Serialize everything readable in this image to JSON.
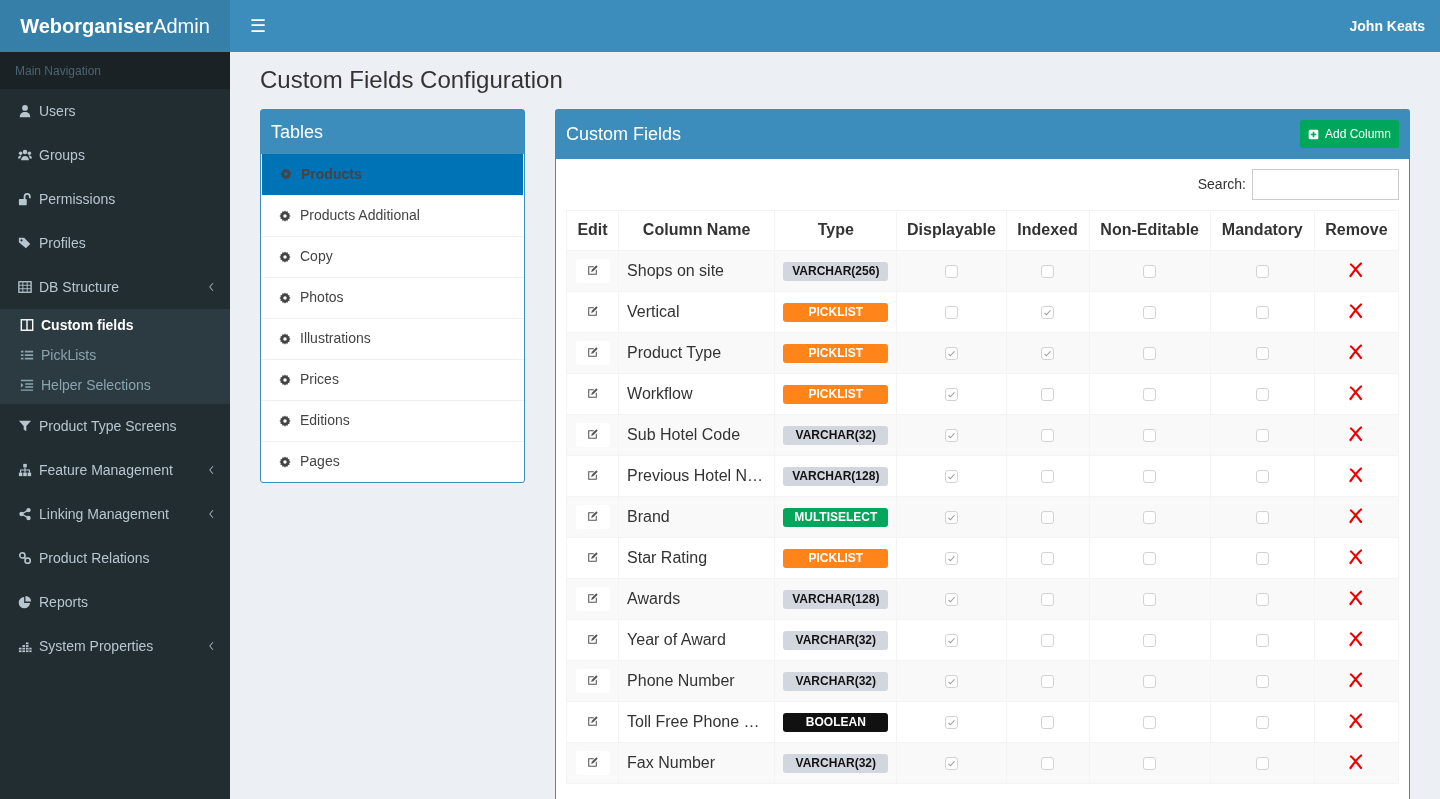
{
  "brand": {
    "bold": "Weborganiser",
    "light": "Admin"
  },
  "menu_toggle": "☰",
  "user": "John Keats",
  "sidebar": {
    "header": "Main Navigation",
    "items": [
      {
        "label": "Users",
        "submenu": false
      },
      {
        "label": "Groups",
        "submenu": false
      },
      {
        "label": "Permissions",
        "submenu": false
      },
      {
        "label": "Profiles",
        "submenu": false
      },
      {
        "label": "DB Structure",
        "submenu": true,
        "children": [
          {
            "label": "Custom fields",
            "selected": true
          },
          {
            "label": "PickLists",
            "selected": false
          },
          {
            "label": "Helper Selections",
            "selected": false
          }
        ]
      },
      {
        "label": "Product Type Screens",
        "submenu": false
      },
      {
        "label": "Feature Management",
        "submenu": true
      },
      {
        "label": "Linking Management",
        "submenu": true
      },
      {
        "label": "Product Relations",
        "submenu": false
      },
      {
        "label": "Reports",
        "submenu": false
      },
      {
        "label": "System Properties",
        "submenu": true
      }
    ]
  },
  "page_title": "Custom Fields Configuration",
  "tables_panel": {
    "title": "Tables",
    "items": [
      {
        "label": "Products",
        "selected": true
      },
      {
        "label": "Products Additional",
        "selected": false
      },
      {
        "label": "Copy",
        "selected": false
      },
      {
        "label": "Photos",
        "selected": false
      },
      {
        "label": "Illustrations",
        "selected": false
      },
      {
        "label": "Prices",
        "selected": false
      },
      {
        "label": "Editions",
        "selected": false
      },
      {
        "label": "Pages",
        "selected": false
      }
    ]
  },
  "fields_panel": {
    "title": "Custom Fields",
    "add_button": "Add Column",
    "search_label": "Search:",
    "columns": [
      "Edit",
      "Column Name",
      "Type",
      "Displayable",
      "Indexed",
      "Non-Editable",
      "Mandatory",
      "Remove"
    ],
    "rows": [
      {
        "name": "Shops on site",
        "type": "VARCHAR(256)",
        "kind": "varchar",
        "displayable": false,
        "indexed": false,
        "non_editable": false,
        "mandatory": false
      },
      {
        "name": "Vertical",
        "type": "PICKLIST",
        "kind": "picklist",
        "displayable": false,
        "indexed": true,
        "non_editable": false,
        "mandatory": false
      },
      {
        "name": "Product Type",
        "type": "PICKLIST",
        "kind": "picklist",
        "displayable": true,
        "indexed": true,
        "non_editable": false,
        "mandatory": false
      },
      {
        "name": "Workflow",
        "type": "PICKLIST",
        "kind": "picklist",
        "displayable": true,
        "indexed": false,
        "non_editable": false,
        "mandatory": false
      },
      {
        "name": "Sub Hotel Code",
        "type": "VARCHAR(32)",
        "kind": "varchar",
        "displayable": true,
        "indexed": false,
        "non_editable": false,
        "mandatory": false
      },
      {
        "name": "Previous Hotel N…",
        "type": "VARCHAR(128)",
        "kind": "varchar",
        "displayable": true,
        "indexed": false,
        "non_editable": false,
        "mandatory": false
      },
      {
        "name": "Brand",
        "type": "MULTISELECT",
        "kind": "multiselect",
        "displayable": true,
        "indexed": false,
        "non_editable": false,
        "mandatory": false
      },
      {
        "name": "Star Rating",
        "type": "PICKLIST",
        "kind": "picklist",
        "displayable": true,
        "indexed": false,
        "non_editable": false,
        "mandatory": false
      },
      {
        "name": "Awards",
        "type": "VARCHAR(128)",
        "kind": "varchar",
        "displayable": true,
        "indexed": false,
        "non_editable": false,
        "mandatory": false
      },
      {
        "name": "Year of Award",
        "type": "VARCHAR(32)",
        "kind": "varchar",
        "displayable": true,
        "indexed": false,
        "non_editable": false,
        "mandatory": false
      },
      {
        "name": "Phone Number",
        "type": "VARCHAR(32)",
        "kind": "varchar",
        "displayable": true,
        "indexed": false,
        "non_editable": false,
        "mandatory": false
      },
      {
        "name": "Toll Free Phone …",
        "type": "BOOLEAN",
        "kind": "boolean",
        "displayable": true,
        "indexed": false,
        "non_editable": false,
        "mandatory": false
      },
      {
        "name": "Fax Number",
        "type": "VARCHAR(32)",
        "kind": "varchar",
        "displayable": true,
        "indexed": false,
        "non_editable": false,
        "mandatory": false
      }
    ]
  }
}
